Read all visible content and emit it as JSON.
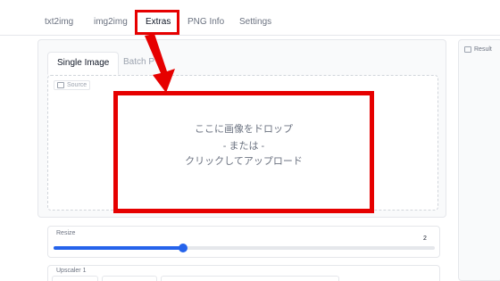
{
  "tabs": [
    {
      "label": "txt2img"
    },
    {
      "label": "img2img"
    },
    {
      "label": "Extras"
    },
    {
      "label": "PNG Info"
    },
    {
      "label": "Settings"
    }
  ],
  "active_tab": "Extras",
  "subtabs": [
    {
      "label": "Single Image"
    },
    {
      "label": "Batch P"
    }
  ],
  "source": {
    "label": "Source",
    "icon": "image-icon"
  },
  "dropzone": {
    "line1": "ここに画像をドロップ",
    "line2": "- または -",
    "line3": "クリックしてアップロード"
  },
  "result": {
    "label": "Result",
    "icon": "image-icon"
  },
  "resize": {
    "label": "Resize",
    "value": "2",
    "fraction": 0.34
  },
  "upscaler": {
    "label": "Upscaler 1"
  },
  "colors": {
    "highlight": "#e60000",
    "accent": "#2563eb"
  }
}
